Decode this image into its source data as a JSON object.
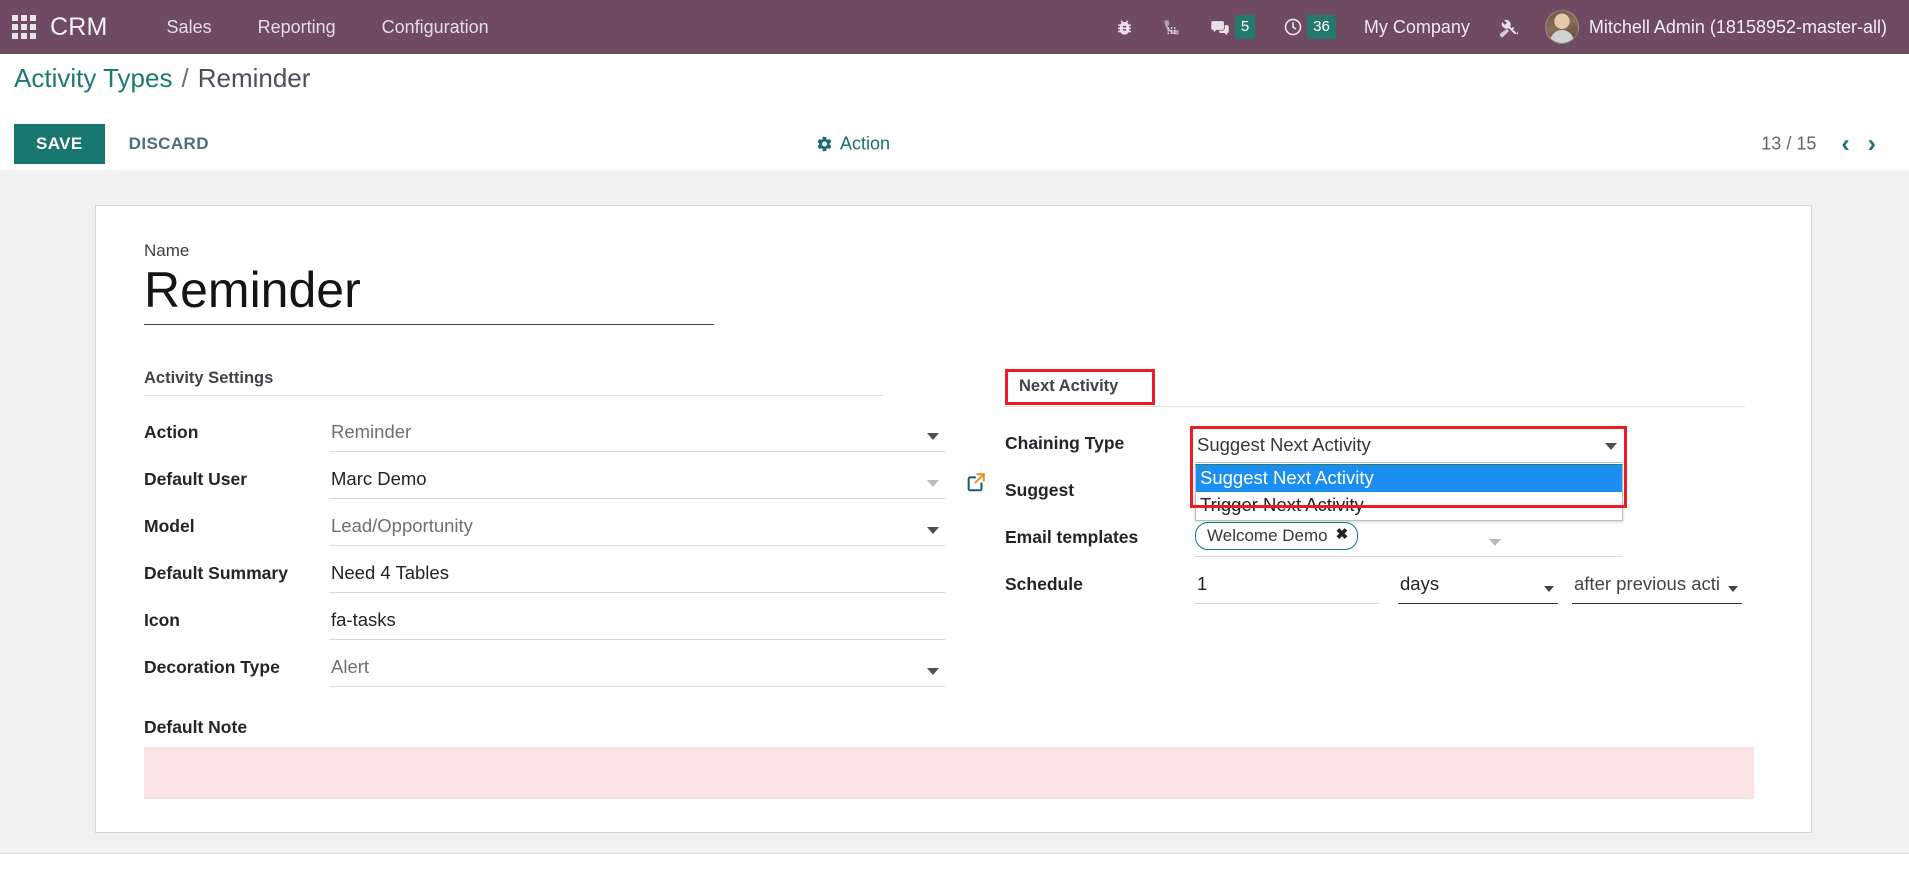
{
  "navbar": {
    "apps_icon": "grid-apps-icon",
    "brand": "CRM",
    "menu": [
      {
        "label": "Sales"
      },
      {
        "label": "Reporting"
      },
      {
        "label": "Configuration"
      }
    ],
    "systray": [
      {
        "name": "bug-icon",
        "badge": ""
      },
      {
        "name": "dialpad-icon",
        "badge": ""
      },
      {
        "name": "messages-icon",
        "badge": "5"
      },
      {
        "name": "activities-clock-icon",
        "badge": "36"
      }
    ],
    "company": "My Company",
    "tools_icon": "wrench-screwdriver-icon",
    "user": "Mitchell Admin (18158952-master-all)"
  },
  "breadcrumb": {
    "root": "Activity Types",
    "separator": "/",
    "current": "Reminder"
  },
  "actionbar": {
    "save_label": "SAVE",
    "discard_label": "DISCARD",
    "action_label": "Action",
    "pager": "13 / 15",
    "prev_icon": "‹",
    "next_icon": "›"
  },
  "form": {
    "name_label": "Name",
    "name_value": "Reminder",
    "left_group_title": "Activity Settings",
    "right_group_title": "Next Activity",
    "fields_left": [
      {
        "label": "Action",
        "value": "Reminder",
        "type": "select",
        "muted": true
      },
      {
        "label": "Default User",
        "value": "Marc Demo",
        "type": "many2one",
        "muted": false
      },
      {
        "label": "Model",
        "value": "Lead/Opportunity",
        "type": "select",
        "muted": true
      },
      {
        "label": "Default Summary",
        "value": "Need 4 Tables",
        "type": "text",
        "muted": false
      },
      {
        "label": "Icon",
        "value": "fa-tasks",
        "type": "text",
        "muted": false
      },
      {
        "label": "Decoration Type",
        "value": "Alert",
        "type": "select",
        "muted": true
      }
    ],
    "chaining": {
      "label": "Chaining Type",
      "value": "Suggest Next Activity",
      "options": [
        {
          "label": "Suggest Next Activity",
          "selected": true
        },
        {
          "label": "Trigger Next Activity",
          "selected": false
        }
      ]
    },
    "suggest": {
      "label": "Suggest",
      "value": ""
    },
    "email_templates": {
      "label": "Email templates",
      "tags": [
        {
          "label": "Welcome Demo",
          "remove_icon": "✖"
        }
      ]
    },
    "schedule": {
      "label": "Schedule",
      "amount": "1",
      "unit": "days",
      "reference": "after previous acti"
    },
    "note_label": "Default Note",
    "note_value": ""
  },
  "colors": {
    "navbar": "#6e4b63",
    "accent_teal": "#17776e",
    "link_teal": "#1d7a73",
    "badge": "#24786e",
    "highlight_red": "#ec1c24",
    "dropdown_selected": "#1b8ef2",
    "required_field": "#fce4e4"
  }
}
